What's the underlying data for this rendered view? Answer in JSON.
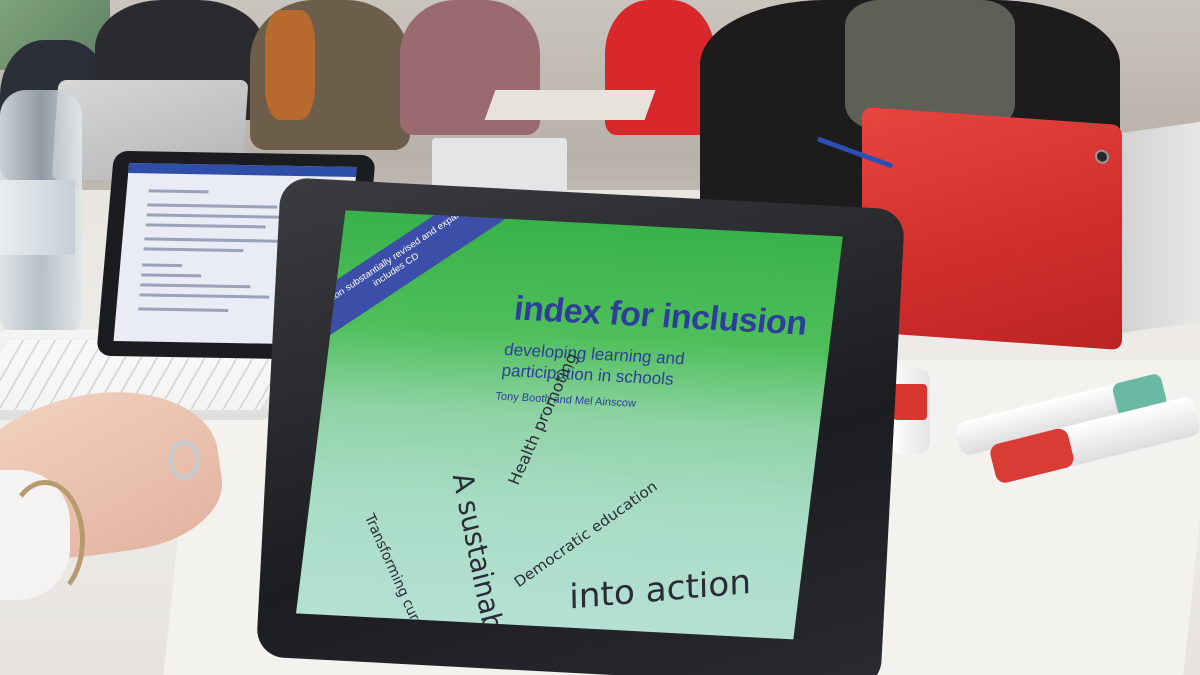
{
  "photo": {
    "main_tablet": {
      "book_cover": {
        "banner": "Third edition substantially revised and expanded – includes CD",
        "title": "index for inclusion",
        "subtitle": "developing learning and participation in schools",
        "authors": "Tony Booth and Mel Ainscow",
        "handwriting": [
          "A sustainabl",
          "Health promoting",
          "Democratic education",
          "Transforming curri",
          "into action"
        ],
        "colors": {
          "cover_green": "#38b24a",
          "cover_blue_text": "#2d3f9a",
          "banner_blue": "#3c4ea8"
        }
      }
    },
    "objects": [
      "water-bottle",
      "laptop",
      "tablet-with-keyboard",
      "red-tablet-case",
      "markers",
      "pen",
      "hand"
    ],
    "accent_colors": {
      "red_case": "#d9362f",
      "marker_cap_green": "#6ab9a2",
      "marker_cap_red": "#d93b35"
    }
  }
}
